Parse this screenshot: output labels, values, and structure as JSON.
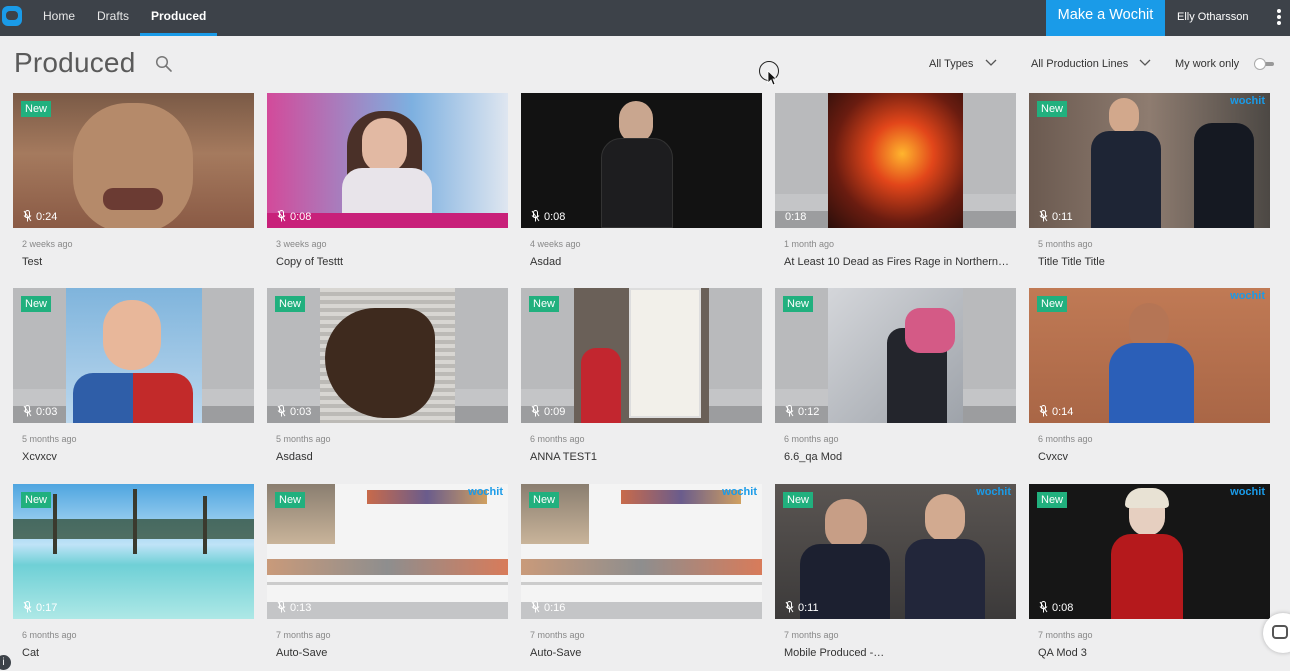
{
  "nav": {
    "home": "Home",
    "drafts": "Drafts",
    "produced": "Produced",
    "make_button": "Make a Wochit",
    "user_name": "Elly Otharsson"
  },
  "header": {
    "title": "Produced",
    "filter_types": "All Types",
    "filter_lines": "All Production Lines",
    "my_work_label": "My work only"
  },
  "colors": {
    "accent": "#1a9be8",
    "topbar": "#3d4249",
    "badge": "#21b07e"
  },
  "badge_label": "New",
  "watermark": "wochit",
  "videos": [
    {
      "duration": "0:24",
      "ago": "2 weeks ago",
      "title": "Test",
      "new": true
    },
    {
      "duration": "0:08",
      "ago": "3 weeks ago",
      "title": "Copy of Testtt",
      "new": false
    },
    {
      "duration": "0:08",
      "ago": "4 weeks ago",
      "title": "Asdad",
      "new": false
    },
    {
      "duration": "0:18",
      "ago": "1 month ago",
      "title": "At Least 10 Dead as Fires Rage in Northern…",
      "new": false
    },
    {
      "duration": "0:11",
      "ago": "5 months ago",
      "title": "Title Title Title",
      "new": true
    },
    {
      "duration": "0:03",
      "ago": "5 months ago",
      "title": "Xcvxcv",
      "new": true
    },
    {
      "duration": "0:03",
      "ago": "5 months ago",
      "title": "Asdasd",
      "new": true
    },
    {
      "duration": "0:09",
      "ago": "6 months ago",
      "title": "ANNA TEST1",
      "new": true
    },
    {
      "duration": "0:12",
      "ago": "6 months ago",
      "title": "6.6_qa Mod",
      "new": true
    },
    {
      "duration": "0:14",
      "ago": "6 months ago",
      "title": "Cvxcv",
      "new": true
    },
    {
      "duration": "0:17",
      "ago": "6 months ago",
      "title": "Cat",
      "new": true
    },
    {
      "duration": "0:13",
      "ago": "7 months ago",
      "title": "Auto-Save",
      "new": true
    },
    {
      "duration": "0:16",
      "ago": "7 months ago",
      "title": "Auto-Save",
      "new": true
    },
    {
      "duration": "0:11",
      "ago": "7 months ago",
      "title": "Mobile Produced -…",
      "new": true
    },
    {
      "duration": "0:08",
      "ago": "7 months ago",
      "title": "QA Mod 3",
      "new": true
    }
  ]
}
